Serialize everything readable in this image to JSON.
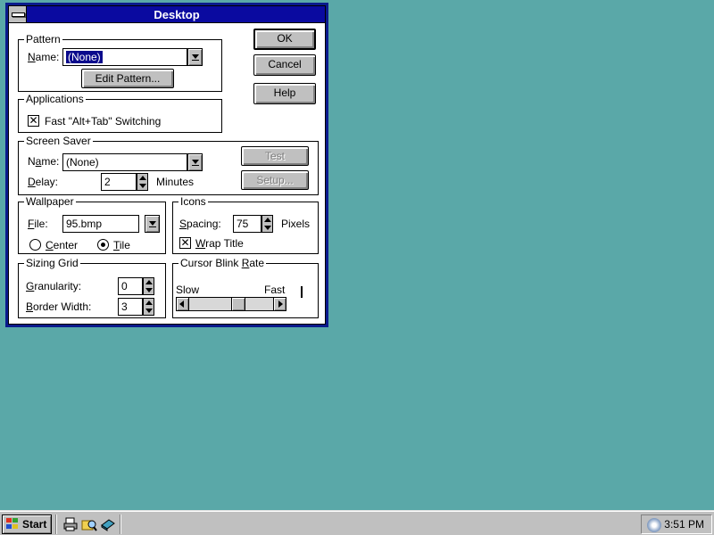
{
  "window": {
    "title": "Desktop"
  },
  "buttons": {
    "ok": "OK",
    "cancel": "Cancel",
    "help": "Help",
    "test": "Test",
    "setup": "Setup..."
  },
  "pattern": {
    "group_title": "Pattern",
    "name_label": "Name:",
    "name_value": "(None)",
    "edit_button": "Edit Pattern..."
  },
  "applications": {
    "group_title": "Applications",
    "fast_switch_label": "Fast \"Alt+Tab\" Switching",
    "fast_switch_checked": true
  },
  "screen_saver": {
    "group_title": "Screen Saver",
    "name_label": "Name:",
    "name_value": "(None)",
    "delay_label": "Delay:",
    "delay_value": "2",
    "delay_unit": "Minutes"
  },
  "wallpaper": {
    "group_title": "Wallpaper",
    "file_label": "File:",
    "file_value": "95.bmp",
    "center_label": "Center",
    "tile_label": "Tile",
    "selected": "Tile"
  },
  "icons": {
    "group_title": "Icons",
    "spacing_label": "Spacing:",
    "spacing_value": "75",
    "spacing_unit": "Pixels",
    "wrap_title_label": "Wrap Title",
    "wrap_title_checked": true
  },
  "sizing_grid": {
    "group_title": "Sizing Grid",
    "granularity_label": "Granularity:",
    "granularity_value": "0",
    "border_width_label": "Border Width:",
    "border_width_value": "3"
  },
  "cursor_blink": {
    "group_title": "Cursor Blink Rate",
    "slow_label": "Slow",
    "fast_label": "Fast",
    "rate_fraction": 0.6
  },
  "taskbar": {
    "start_label": "Start",
    "clock": "3:51 PM"
  },
  "colors": {
    "desktop": "#5aa8a8",
    "title_bar": "#0a0aa0",
    "window_frame": "#0a1a8c",
    "button_face": "#c0c0c0"
  }
}
